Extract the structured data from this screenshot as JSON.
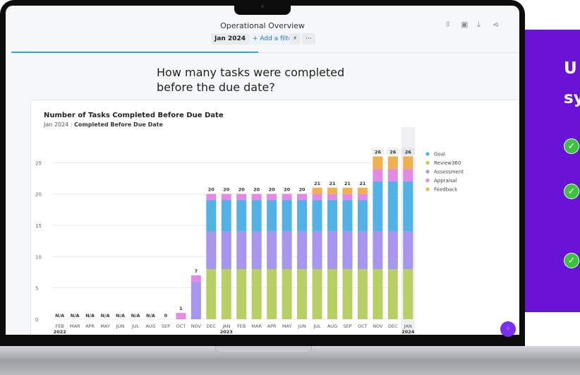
{
  "dashboard": {
    "title": "Operational Overview",
    "period_pill": "Jan 2024",
    "add_filter_label": "+ Add a filter",
    "flash_icon": "lightning-icon",
    "more_label": "···",
    "toolbar_icons": [
      "collapse-icon",
      "comment-icon",
      "download-icon",
      "share-icon"
    ],
    "question": "How many tasks were completed before the due date?"
  },
  "card": {
    "title": "Number of Tasks Completed Before Due Date",
    "subtitle_period": "Jan 2024",
    "subtitle_filter": "Completed Before Due Date"
  },
  "promo": {
    "heading_line1": "U",
    "heading_line2": "sy",
    "check_icon": "check-circle-icon",
    "bg_color": "#6a12d6"
  },
  "chart_data": {
    "type": "bar",
    "stacked": true,
    "categories": [
      "FEB 2022",
      "MAR",
      "APR",
      "MAY",
      "JUN",
      "JUL",
      "AUG",
      "SEP",
      "OCT",
      "NOV",
      "DEC",
      "JAN 2023",
      "FEB",
      "MAR",
      "APR",
      "MAY",
      "JUN",
      "JUL",
      "AUG",
      "SEP",
      "OCT",
      "NOV",
      "DEC",
      "JAN 2024"
    ],
    "tick_labels": [
      [
        "FEB",
        "2022"
      ],
      [
        "MAR"
      ],
      [
        "APR"
      ],
      [
        "MAY"
      ],
      [
        "JUN"
      ],
      [
        "JUL"
      ],
      [
        "AUG"
      ],
      [
        "SEP"
      ],
      [
        "OCT"
      ],
      [
        "NOV"
      ],
      [
        "DEC"
      ],
      [
        "JAN",
        "2023"
      ],
      [
        "FEB"
      ],
      [
        "MAR"
      ],
      [
        "APR"
      ],
      [
        "MAY"
      ],
      [
        "JUN"
      ],
      [
        "JUL"
      ],
      [
        "AUG"
      ],
      [
        "SEP"
      ],
      [
        "OCT"
      ],
      [
        "NOV"
      ],
      [
        "DEC"
      ],
      [
        "JAN",
        "2024"
      ]
    ],
    "totals": [
      "N/A",
      "N/A",
      "N/A",
      "N/A",
      "N/A",
      "N/A",
      "N/A",
      "0",
      "1",
      "7",
      "20",
      "20",
      "20",
      "20",
      "20",
      "20",
      "20",
      "21",
      "21",
      "21",
      "21",
      "26",
      "26",
      "26"
    ],
    "series": [
      {
        "name": "Goal",
        "color": "#52b2e8",
        "values": [
          0,
          0,
          0,
          0,
          0,
          0,
          0,
          0,
          0,
          0,
          5,
          5,
          5,
          5,
          5,
          5,
          5,
          5,
          5,
          5,
          5,
          8,
          8,
          8
        ]
      },
      {
        "name": "Review360",
        "color": "#b7cf64",
        "values": [
          0,
          0,
          0,
          0,
          0,
          0,
          0,
          0,
          0,
          0,
          8,
          8,
          8,
          8,
          8,
          8,
          8,
          8,
          8,
          8,
          8,
          8,
          8,
          8
        ]
      },
      {
        "name": "Assessment",
        "color": "#a795ee",
        "values": [
          0,
          0,
          0,
          0,
          0,
          0,
          0,
          0,
          0,
          6,
          6,
          6,
          6,
          6,
          6,
          6,
          6,
          6,
          6,
          6,
          6,
          6,
          6,
          6
        ]
      },
      {
        "name": "Appraisal",
        "color": "#e28ae6",
        "values": [
          0,
          0,
          0,
          0,
          0,
          0,
          0,
          0,
          1,
          1,
          1,
          1,
          1,
          1,
          1,
          1,
          1,
          1,
          1,
          1,
          1,
          2,
          2,
          2
        ]
      },
      {
        "name": "Feedback",
        "color": "#f0b04c",
        "values": [
          0,
          0,
          0,
          0,
          0,
          0,
          0,
          0,
          0,
          0,
          0,
          0,
          0,
          0,
          0,
          0,
          0,
          1,
          1,
          1,
          1,
          2,
          2,
          2
        ]
      }
    ],
    "stack_order": [
      "Review360",
      "Assessment",
      "Goal",
      "Appraisal",
      "Feedback"
    ],
    "y_ticks": [
      0,
      5,
      10,
      15,
      20,
      25
    ],
    "ylim": [
      0,
      30
    ],
    "grid": true,
    "legend_position": "right",
    "highlighted_category": "JAN 2024"
  }
}
